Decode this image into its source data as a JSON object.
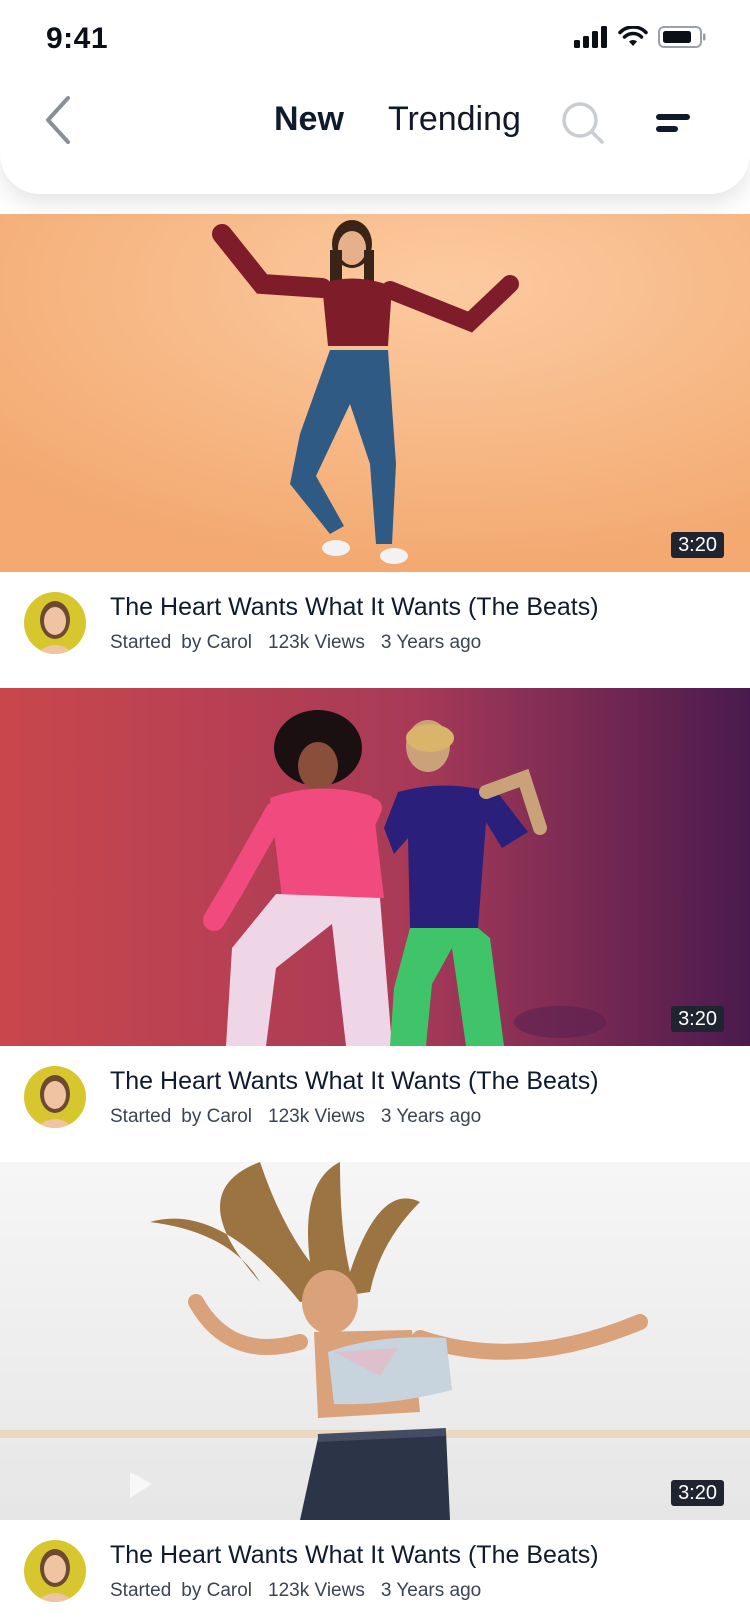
{
  "status_bar": {
    "time": "9:41"
  },
  "header": {
    "tabs": [
      {
        "label": "New",
        "active": true
      },
      {
        "label": "Trending",
        "active": false
      }
    ],
    "icons": {
      "back": "chevron-left-icon",
      "search": "search-icon",
      "menu": "menu-icon"
    }
  },
  "videos": [
    {
      "duration": "3:20",
      "title": "The Heart Wants What It Wants (The Beats)",
      "status": "Started",
      "author": "by Carol",
      "views": "123k Views",
      "age": "3 Years ago"
    },
    {
      "duration": "3:20",
      "title": "The Heart Wants What It Wants (The Beats)",
      "status": "Started",
      "author": "by Carol",
      "views": "123k Views",
      "age": "3 Years ago"
    },
    {
      "duration": "3:20",
      "title": "The Heart Wants What It Wants (The Beats)",
      "status": "Started",
      "author": "by Carol",
      "views": "123k Views",
      "age": "3 Years ago"
    }
  ],
  "colors": {
    "accent_text": "#0f1b2d",
    "meta_text": "#3b4452",
    "duration_badge": "#1f2430"
  }
}
